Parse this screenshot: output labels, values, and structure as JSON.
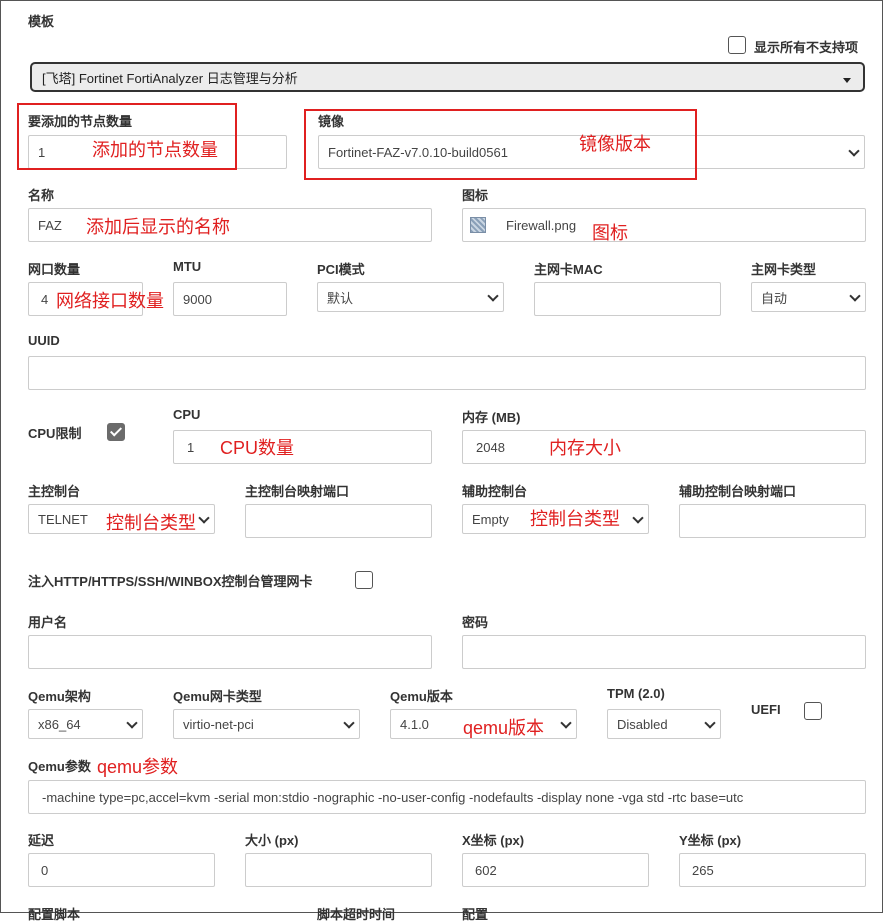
{
  "template": {
    "label": "模板",
    "show_unsupported_label": "显示所有不支持项",
    "selected": "[飞塔] Fortinet FortiAnalyzer 日志管理与分析"
  },
  "nodes": {
    "label": "要添加的节点数量",
    "value": "1",
    "annotation": "添加的节点数量"
  },
  "image": {
    "label": "镜像",
    "value": "Fortinet-FAZ-v7.0.10-build0561",
    "annotation": "镜像版本"
  },
  "name": {
    "label": "名称",
    "value": "FAZ",
    "annotation": "添加后显示的名称"
  },
  "icon": {
    "label": "图标",
    "value": "Firewall.png",
    "icon_name": "firewall-icon",
    "annotation": "图标"
  },
  "ethernet": {
    "label": "网口数量",
    "value": "4",
    "annotation": "网络接口数量"
  },
  "mtu": {
    "label": "MTU",
    "value": "9000"
  },
  "pci": {
    "label": "PCI模式",
    "value": "默认"
  },
  "mac": {
    "label": "主网卡MAC",
    "value": ""
  },
  "nic_type": {
    "label": "主网卡类型",
    "value": "自动"
  },
  "uuid": {
    "label": "UUID",
    "value": ""
  },
  "cpulimit": {
    "label": "CPU限制",
    "checked": true
  },
  "cpu": {
    "label": "CPU",
    "value": "1",
    "annotation": "CPU数量"
  },
  "ram": {
    "label": "内存 (MB)",
    "value": "2048",
    "annotation": "内存大小"
  },
  "console": {
    "label": "主控制台",
    "value": "TELNET",
    "annotation": "控制台类型"
  },
  "console_port": {
    "label": "主控制台映射端口",
    "value": ""
  },
  "console2": {
    "label": "辅助控制台",
    "value": "Empty",
    "annotation": "控制台类型"
  },
  "console2_port": {
    "label": "辅助控制台映射端口",
    "value": ""
  },
  "inject": {
    "label": "注入HTTP/HTTPS/SSH/WINBOX控制台管理网卡",
    "checked": false
  },
  "username": {
    "label": "用户名",
    "value": ""
  },
  "password": {
    "label": "密码",
    "value": ""
  },
  "qemu_arch": {
    "label": "Qemu架构",
    "value": "x86_64"
  },
  "qemu_nic": {
    "label": "Qemu网卡类型",
    "value": "virtio-net-pci"
  },
  "qemu_version": {
    "label": "Qemu版本",
    "value": "4.1.0",
    "annotation": "qemu版本"
  },
  "tpm": {
    "label": "TPM (2.0)",
    "value": "Disabled"
  },
  "uefi": {
    "label": "UEFI",
    "checked": false
  },
  "qemu_options": {
    "label": "Qemu参数",
    "annotation": "qemu参数",
    "value": "-machine type=pc,accel=kvm -serial mon:stdio -nographic -no-user-config -nodefaults -display none -vga std -rtc base=utc"
  },
  "delay": {
    "label": "延迟",
    "value": "0"
  },
  "size": {
    "label": "大小 (px)",
    "value": ""
  },
  "x": {
    "label": "X坐标 (px)",
    "value": "602"
  },
  "y": {
    "label": "Y坐标 (px)",
    "value": "265"
  },
  "bottom": {
    "config_script": "配置脚本",
    "script_timeout": "脚本超时时间",
    "config": "配置"
  },
  "colors": {
    "annotation": "#e02020",
    "checked": "#6b6b6b",
    "border": "#cccccc"
  }
}
